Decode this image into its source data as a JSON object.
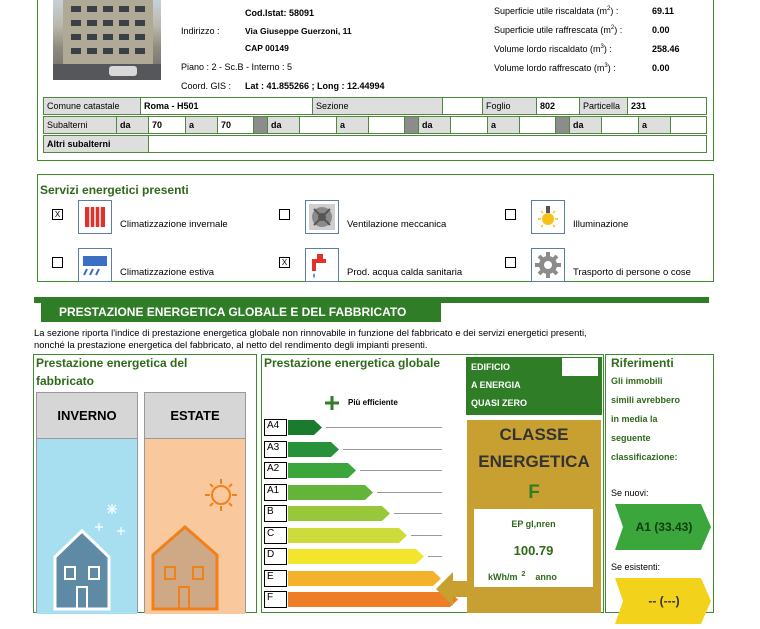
{
  "property": {
    "cod_istat": "Cod.Istat: 58091",
    "indirizzo_label": "Indirizzo :",
    "indirizzo_value": "Via Giuseppe Guerzoni, 11",
    "cap": "CAP 00149",
    "piano": "Piano : 2 - Sc.B - Interno : 5",
    "coord_label": "Coord. GIS :",
    "coord_value": "Lat : 41.855266 ; Long : 12.44994"
  },
  "surfaces": [
    {
      "label": "Superficie utile riscaldata (m",
      "sup": "2",
      "close": ") :",
      "value": "69.11"
    },
    {
      "label": "Superficie utile raffrescata (m",
      "sup": "2",
      "close": ") :",
      "value": "0.00"
    },
    {
      "label": "Volume lordo riscaldato (m",
      "sup": "3",
      "close": ") :",
      "value": "258.46"
    },
    {
      "label": "Volume lordo raffrescato (m",
      "sup": "3",
      "close": ") :",
      "value": "0.00"
    }
  ],
  "cadastral": {
    "comune_label": "Comune catastale",
    "comune_value": "Roma - H501",
    "sezione_label": "Sezione",
    "sezione_value": "",
    "foglio_label": "Foglio",
    "foglio_value": "802",
    "particella_label": "Particella",
    "particella_value": "231",
    "subalterni_label": "Subalterni",
    "da": "da",
    "a": "a",
    "sub_from": "70",
    "sub_to": "70",
    "altri_label": "Altri subalterni"
  },
  "services": {
    "title": "Servizi energetici presenti",
    "items": [
      {
        "label": "Climatizzazione invernale",
        "checked": "X",
        "icon": "radiator-icon"
      },
      {
        "label": "Ventilazione meccanica",
        "checked": "",
        "icon": "fan-icon"
      },
      {
        "label": "Illuminazione",
        "checked": "",
        "icon": "lightbulb-icon"
      },
      {
        "label": "Climatizzazione estiva",
        "checked": "",
        "icon": "air-conditioner-icon"
      },
      {
        "label": "Prod. acqua calda sanitaria",
        "checked": "X",
        "icon": "water-tap-icon"
      },
      {
        "label": "Trasporto di persone o cose",
        "checked": "",
        "icon": "gear-icon"
      }
    ]
  },
  "performance": {
    "banner": "PRESTAZIONE ENERGETICA GLOBALE  E DEL FABBRICATO",
    "description_1": "La sezione riporta l'indice di prestazione energetica globale non rinnovabile in funzione del fabbricato e dei servizi energetici presenti,",
    "description_2": "nonché la prestazione energetica del fabbricato, al netto del rendimento degli impianti presenti.",
    "fabbricato_title_1": "Prestazione energetica del",
    "fabbricato_title_2": "fabbricato",
    "inverno": "INVERNO",
    "estate": "ESTATE",
    "globale_title": "Prestazione energetica globale",
    "piu_efficiente": "Più efficiente",
    "nzeb_1": "EDIFICIO",
    "nzeb_2": "A ENERGIA",
    "nzeb_3": "QUASI ZERO",
    "classe_1": "CLASSE",
    "classe_2": "ENERGETICA",
    "classe_value": "F",
    "ep_label": "EP gl,nren",
    "ep_value": "100.79",
    "ep_unit": "kWh/m",
    "ep_sup": "2",
    "ep_unit2": "anno",
    "classes": [
      {
        "label": "A4",
        "color": "#1a7a2e"
      },
      {
        "label": "A3",
        "color": "#27923a"
      },
      {
        "label": "A2",
        "color": "#3aa63b"
      },
      {
        "label": "A1",
        "color": "#63b53a"
      },
      {
        "label": "B",
        "color": "#98c83a"
      },
      {
        "label": "C",
        "color": "#cddc3a"
      },
      {
        "label": "D",
        "color": "#f2e52b"
      },
      {
        "label": "E",
        "color": "#f3b22a"
      },
      {
        "label": "F",
        "color": "#ee7d26"
      }
    ],
    "riferimenti_title": "Riferimenti",
    "rif_1": "Gli immobili",
    "rif_2": "simili avrebbero",
    "rif_3": "in media la",
    "rif_4": "seguente",
    "rif_5": "classificazione:",
    "se_nuovi": "Se nuovi:",
    "nuovi_value": "A1 (33.43)",
    "se_esistenti": "Se esistenti:",
    "esistenti_value": "-- (---)"
  },
  "colors": {
    "accent_green": "#2f7d26",
    "class_gold": "#c8a032",
    "inverno_bg": "#a8dff0",
    "estate_bg": "#f9c89c"
  }
}
